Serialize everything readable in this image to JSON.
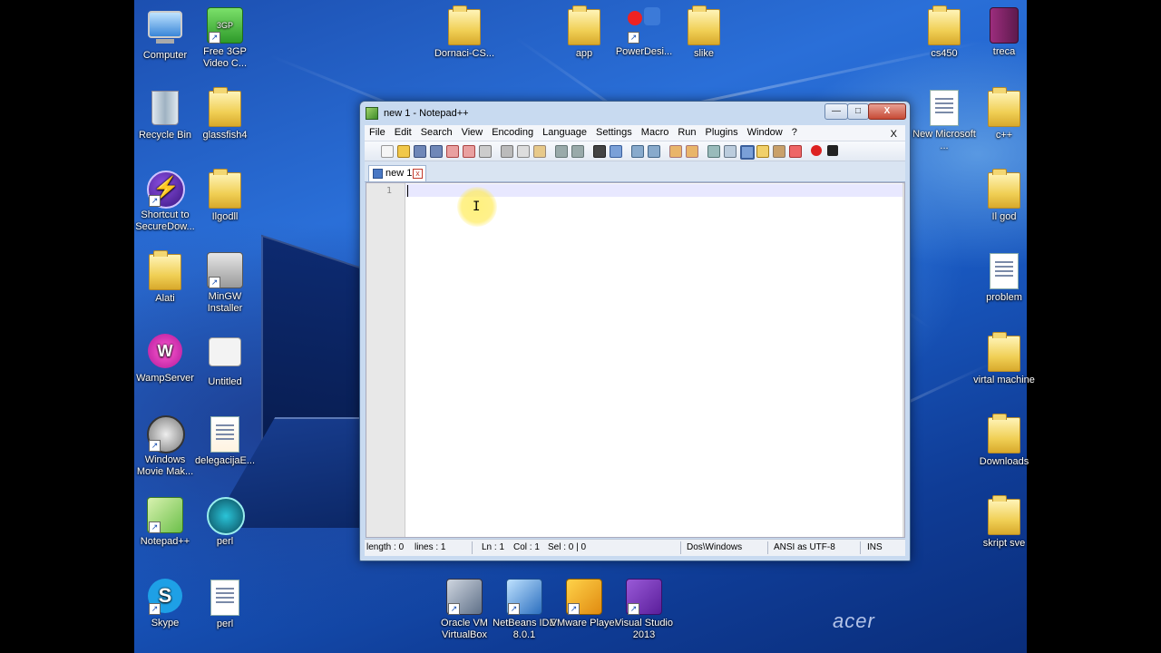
{
  "desktop": {
    "brand": "acer",
    "icons": [
      {
        "label": "Computer",
        "icon": "computer-icon"
      },
      {
        "label": "Free 3GP Video C...",
        "icon": "video-converter-icon"
      },
      {
        "label": "Recycle Bin",
        "icon": "recycle-bin-icon"
      },
      {
        "label": "glassfish4",
        "icon": "folder-icon"
      },
      {
        "label": "Shortcut to SecureDow...",
        "icon": "bolt-icon"
      },
      {
        "label": "Ilgodll",
        "icon": "folder-icon"
      },
      {
        "label": "Alati",
        "icon": "folder-icon"
      },
      {
        "label": "MinGW Installer",
        "icon": "installer-icon"
      },
      {
        "label": "WampServer",
        "icon": "wampserver-icon"
      },
      {
        "label": "Untitled",
        "icon": "image-file-icon"
      },
      {
        "label": "Windows Movie Mak...",
        "icon": "movie-maker-icon"
      },
      {
        "label": "delegacijaE...",
        "icon": "pdf-file-icon"
      },
      {
        "label": "Notepad++",
        "icon": "notepadpp-icon"
      },
      {
        "label": "perl",
        "icon": "perl-icon"
      },
      {
        "label": "Skype",
        "icon": "skype-icon"
      },
      {
        "label": "perl",
        "icon": "document-icon"
      },
      {
        "label": "Dornaci-CS...",
        "icon": "folder-icon"
      },
      {
        "label": "app",
        "icon": "folder-icon"
      },
      {
        "label": "PowerDesi...",
        "icon": "powerdesigner-icon"
      },
      {
        "label": "slike",
        "icon": "folder-icon"
      },
      {
        "label": "cs450",
        "icon": "folder-icon"
      },
      {
        "label": "treca",
        "icon": "archive-icon"
      },
      {
        "label": "New Microsoft ...",
        "icon": "word-document-icon"
      },
      {
        "label": "c++",
        "icon": "folder-icon"
      },
      {
        "label": "Il god",
        "icon": "folder-icon"
      },
      {
        "label": "problem",
        "icon": "word-document-icon"
      },
      {
        "label": "virtal machine",
        "icon": "folder-icon"
      },
      {
        "label": "Downloads",
        "icon": "folder-icon"
      },
      {
        "label": "skript sve",
        "icon": "folder-icon"
      },
      {
        "label": "Oracle VM VirtualBox",
        "icon": "virtualbox-icon"
      },
      {
        "label": "NetBeans IDE 8.0.1",
        "icon": "netbeans-icon"
      },
      {
        "label": "VMware Player",
        "icon": "vmware-icon"
      },
      {
        "label": "Visual Studio 2013",
        "icon": "visual-studio-icon"
      }
    ]
  },
  "window": {
    "title": "new  1 - Notepad++",
    "controls": {
      "minimize": "—",
      "maximize": "□",
      "close": "X"
    },
    "menu": [
      "File",
      "Edit",
      "Search",
      "View",
      "Encoding",
      "Language",
      "Settings",
      "Macro",
      "Run",
      "Plugins",
      "Window",
      "?"
    ],
    "menu_close": "X",
    "tab": {
      "label": "new  1",
      "close": "x"
    },
    "editor": {
      "line_number": "1",
      "content": ""
    },
    "status": {
      "length": "length : 0",
      "lines": "lines : 1",
      "ln": "Ln : 1",
      "col": "Col : 1",
      "sel": "Sel : 0 | 0",
      "eol": "Dos\\Windows",
      "encoding": "ANSI as UTF-8",
      "mode": "INS"
    }
  }
}
